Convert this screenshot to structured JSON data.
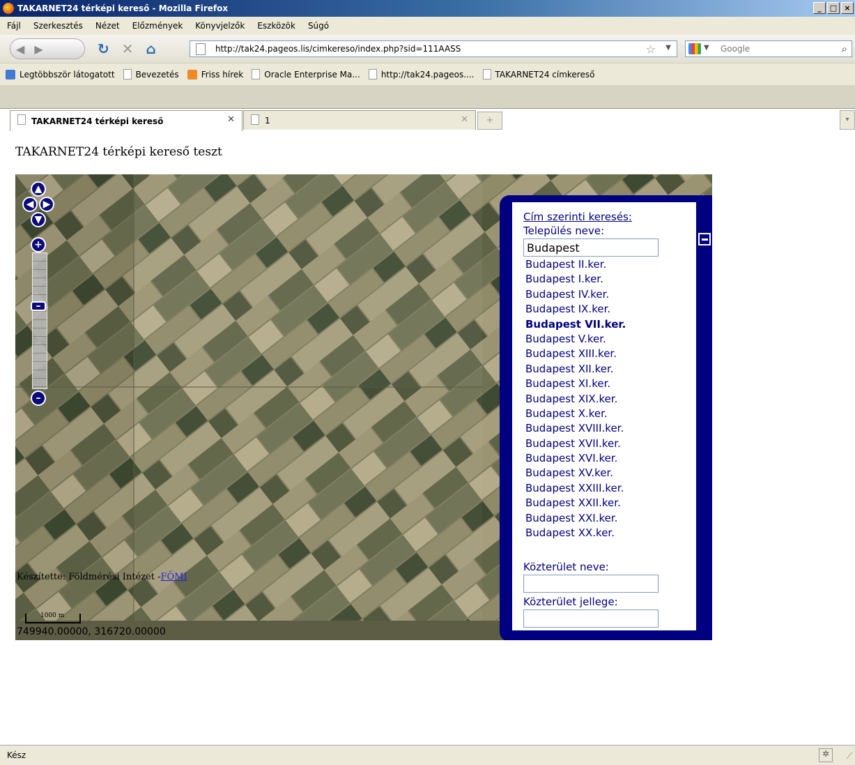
{
  "window": {
    "title": "TAKARNET24 térképi kereső - Mozilla Firefox",
    "min": "_",
    "max": "□",
    "close": "×"
  },
  "menu": [
    "Fájl",
    "Szerkesztés",
    "Nézet",
    "Előzmények",
    "Könyvjelzők",
    "Eszközök",
    "Súgó"
  ],
  "nav": {
    "url": "http://tak24.pageos.lis/cimkereso/index.php?sid=111AASS",
    "search_placeholder": "Google"
  },
  "bookmarks": [
    "Legtöbbször látogatott",
    "Bevezetés",
    "Friss hírek",
    "Oracle Enterprise Ma...",
    "http://tak24.pageos....",
    "TAKARNET24 címkereső"
  ],
  "tabs": [
    {
      "label": "TAKARNET24 térképi kereső"
    },
    {
      "label": "1"
    }
  ],
  "page": {
    "heading": "TAKARNET24 térképi kereső teszt",
    "attribution_prefix": "Készítette: Földmérési Intézet -",
    "attribution_link": "FÖMI",
    "scale_label": "1000 m",
    "coords": "749940.00000, 316720.00000"
  },
  "search_panel": {
    "title": "Cím szerinti keresés:",
    "settlement_label": "Település neve:",
    "settlement_value": "Budapest",
    "suggestions": [
      "Budapest II.ker.",
      "Budapest I.ker.",
      "Budapest IV.ker.",
      "Budapest IX.ker.",
      "Budapest VII.ker.",
      "Budapest V.ker.",
      "Budapest XIII.ker.",
      "Budapest XII.ker.",
      "Budapest XI.ker.",
      "Budapest XIX.ker.",
      "Budapest X.ker.",
      "Budapest XVIII.ker.",
      "Budapest XVII.ker.",
      "Budapest XVI.ker.",
      "Budapest XV.ker.",
      "Budapest XXIII.ker.",
      "Budapest XXII.ker.",
      "Budapest XXI.ker.",
      "Budapest XX.ker."
    ],
    "selected_suggestion": "Budapest VII.ker.",
    "street_label": "Közterület neve:",
    "street_value": "",
    "street_type_label": "Közterület jellege:",
    "street_type_value": ""
  },
  "status": {
    "text": "Kész"
  }
}
